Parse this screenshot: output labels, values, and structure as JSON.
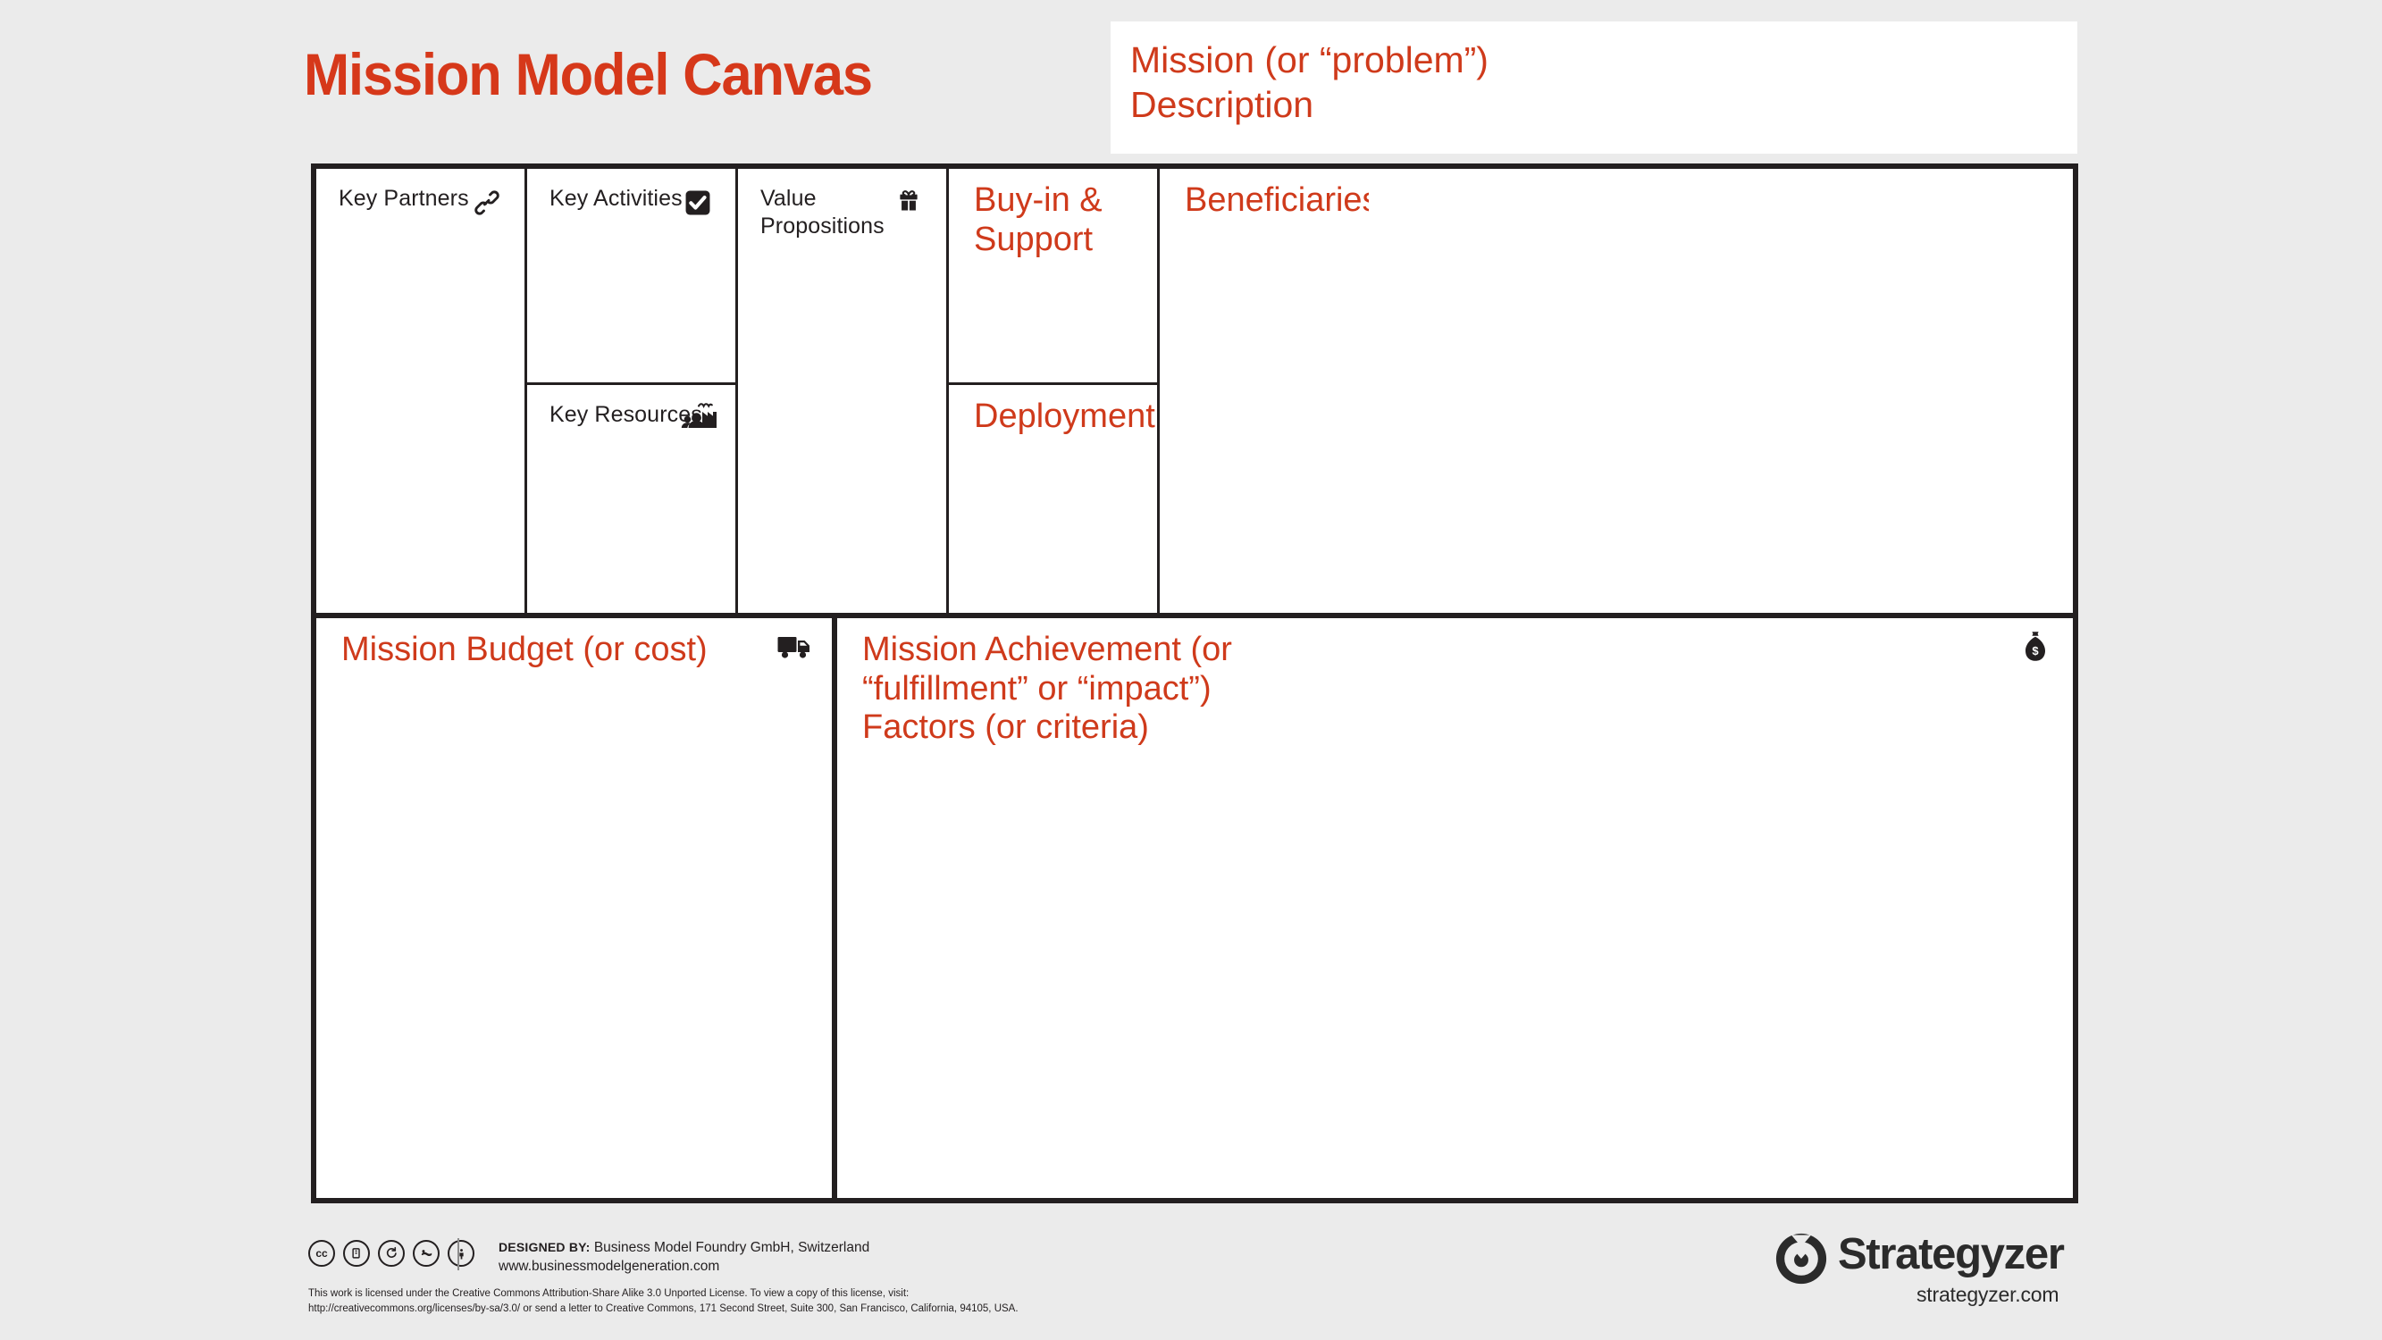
{
  "header": {
    "title": "Mission Model Canvas",
    "mission_description": "Mission (or “problem”)\nDescription"
  },
  "colors": {
    "accent_red": "#cf3a1b",
    "title_red": "#d6381a",
    "ink": "#231f20",
    "page_background": "#ebebeb",
    "cell_background": "#ffffff"
  },
  "canvas": {
    "cells": [
      {
        "id": "key-partners",
        "label": "Key Partners",
        "style": "black",
        "icon": "chain-link-icon"
      },
      {
        "id": "key-activities",
        "label": "Key Activities",
        "style": "black",
        "icon": "checkbox-checked-icon"
      },
      {
        "id": "key-resources",
        "label": "Key Resources",
        "style": "black",
        "icon": "factory-people-icon"
      },
      {
        "id": "value-propositions",
        "label": "Value Propositions",
        "style": "black",
        "icon": "gift-icon"
      },
      {
        "id": "buy-in-and-support",
        "label": "Buy-in &\nSupport",
        "style": "red",
        "icon": null
      },
      {
        "id": "deployment",
        "label": "Deployment",
        "style": "red",
        "icon": null
      },
      {
        "id": "beneficiaries",
        "label": "Beneficiaries",
        "style": "red",
        "icon": null
      },
      {
        "id": "mission-budget",
        "label": "Mission Budget (or cost)",
        "style": "red",
        "icon": "delivery-truck-icon"
      },
      {
        "id": "mission-achievement",
        "label": "Mission Achievement (or\n“fulfillment” or “impact”)\nFactors (or criteria)",
        "style": "red",
        "icon": "money-bag-icon"
      }
    ]
  },
  "footer": {
    "cc_badges": [
      {
        "name": "creative-commons-icon",
        "glyph": "cc"
      },
      {
        "name": "copy-icon",
        "glyph": "⎙"
      },
      {
        "name": "share-alike-icon",
        "glyph": "↺"
      },
      {
        "name": "non-commercial-icon",
        "glyph": "☁"
      },
      {
        "name": "attribution-icon",
        "glyph": "🛈"
      }
    ],
    "designed_by_label": "DESIGNED BY:",
    "designed_by_value": "Business Model Foundry GmbH, Switzerland",
    "designed_by_url": "www.businessmodelgeneration.com",
    "license_text": "This work is licensed under the Creative Commons Attribution-Share Alike 3.0 Unported License. To view a copy of this license, visit:\nhttp://creativecommons.org/licenses/by-sa/3.0/ or send a letter to Creative Commons, 171 Second Street, Suite 300, San Francisco, California, 94105, USA.",
    "brand_name": "Strategyzer",
    "brand_url": "strategyzer.com"
  }
}
